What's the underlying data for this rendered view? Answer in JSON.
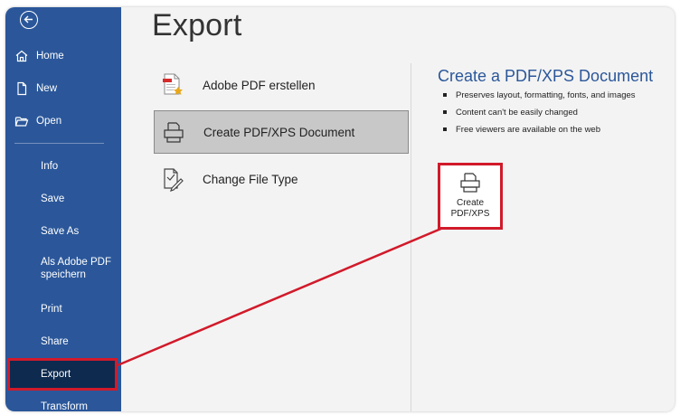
{
  "sidebar": {
    "items": [
      {
        "id": "home",
        "label": "Home",
        "icon": "home-icon"
      },
      {
        "id": "new",
        "label": "New",
        "icon": "new-document-icon"
      },
      {
        "id": "open",
        "label": "Open",
        "icon": "open-folder-icon"
      },
      {
        "id": "info",
        "label": "Info"
      },
      {
        "id": "save",
        "label": "Save"
      },
      {
        "id": "saveas",
        "label": "Save As"
      },
      {
        "id": "adobe",
        "label": "Als Adobe PDF speichern"
      },
      {
        "id": "print",
        "label": "Print"
      },
      {
        "id": "share",
        "label": "Share"
      },
      {
        "id": "export",
        "label": "Export",
        "selected": true
      },
      {
        "id": "transform",
        "label": "Transform"
      }
    ]
  },
  "main": {
    "title": "Export",
    "options": [
      {
        "label": "Adobe PDF erstellen",
        "icon": "adobe-pdf-icon"
      },
      {
        "label": "Create PDF/XPS Document",
        "icon": "pdf-xps-icon",
        "selected": true
      },
      {
        "label": "Change File Type",
        "icon": "change-file-type-icon"
      }
    ]
  },
  "detail": {
    "title": "Create a PDF/XPS Document",
    "bullets": [
      "Preserves layout, formatting, fonts, and images",
      "Content can't be easily changed",
      "Free viewers are available on the web"
    ],
    "button_label_line1": "Create",
    "button_label_line2": "PDF/XPS"
  },
  "colors": {
    "sidebar": "#2b579a",
    "accent_title": "#2b579a",
    "highlight_red": "#d11a2a"
  }
}
